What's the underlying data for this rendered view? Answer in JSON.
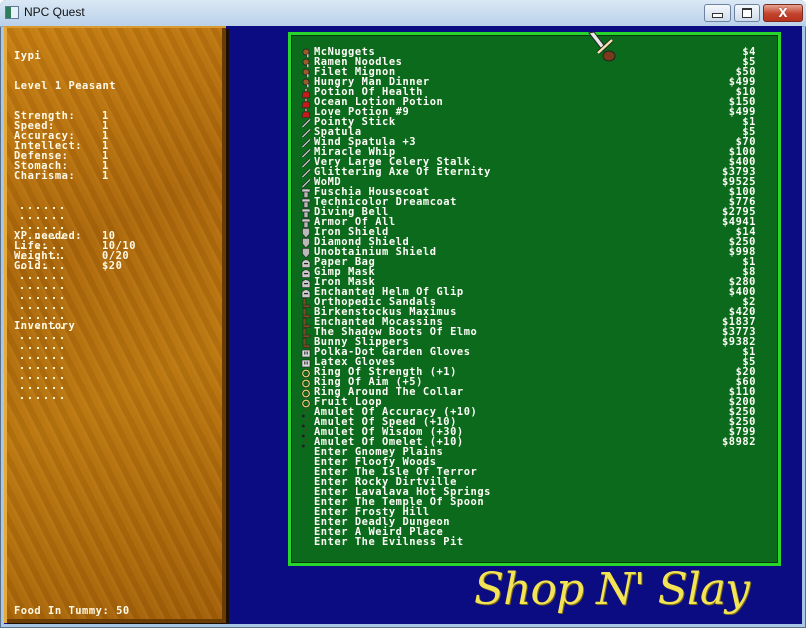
{
  "window": {
    "title": "NPC Quest",
    "controls": {
      "minimize": "minimize",
      "maximize": "maximize",
      "close": "X"
    }
  },
  "character": {
    "name": "Iypi",
    "level_line": "Level 1 Peasant",
    "stats": [
      {
        "label": "Strength:",
        "value": "1"
      },
      {
        "label": "Speed:",
        "value": "1"
      },
      {
        "label": "Accuracy:",
        "value": "1"
      },
      {
        "label": "Intellect:",
        "value": "1"
      },
      {
        "label": "Defense:",
        "value": "1"
      },
      {
        "label": "Stomach:",
        "value": "1"
      },
      {
        "label": "Charisma:",
        "value": "1"
      }
    ],
    "status": [
      {
        "label": "XP needed:",
        "value": "10"
      },
      {
        "label": "Life:",
        "value": "10/10"
      },
      {
        "label": "Weight:",
        "value": "0/20"
      },
      {
        "label": "Gold:",
        "value": "$20"
      }
    ],
    "inventory_label": "Inventory",
    "inventory_empty_slots": 20,
    "food_line": "Food In Tummy: 50"
  },
  "shop": {
    "items": [
      {
        "icon": "food",
        "name": "McNuggets",
        "price": "$4"
      },
      {
        "icon": "food",
        "name": "Ramen Noodles",
        "price": "$5"
      },
      {
        "icon": "food",
        "name": "Filet Mignon",
        "price": "$50"
      },
      {
        "icon": "food",
        "name": "Hungry Man Dinner",
        "price": "$499"
      },
      {
        "icon": "potion",
        "name": "Potion Of Health",
        "price": "$10"
      },
      {
        "icon": "potion",
        "name": "Ocean Lotion Potion",
        "price": "$150"
      },
      {
        "icon": "potion",
        "name": "Love Potion #9",
        "price": "$499"
      },
      {
        "icon": "weapon",
        "name": "Pointy Stick",
        "price": "$1"
      },
      {
        "icon": "weapon",
        "name": "Spatula",
        "price": "$5"
      },
      {
        "icon": "weapon",
        "name": "Wind Spatula +3",
        "price": "$70"
      },
      {
        "icon": "weapon",
        "name": "Miracle Whip",
        "price": "$100"
      },
      {
        "icon": "weapon",
        "name": "Very Large Celery Stalk",
        "price": "$400"
      },
      {
        "icon": "weapon",
        "name": "Glittering Axe Of Eternity",
        "price": "$3793"
      },
      {
        "icon": "weapon",
        "name": "WoMD",
        "price": "$9525"
      },
      {
        "icon": "armor",
        "name": "Fuschia Housecoat",
        "price": "$100"
      },
      {
        "icon": "armor",
        "name": "Technicolor Dreamcoat",
        "price": "$776"
      },
      {
        "icon": "armor",
        "name": "Diving Bell",
        "price": "$2795"
      },
      {
        "icon": "armor",
        "name": "Armor Of All",
        "price": "$4941"
      },
      {
        "icon": "shield",
        "name": "Iron Shield",
        "price": "$14"
      },
      {
        "icon": "shield",
        "name": "Diamond Shield",
        "price": "$250"
      },
      {
        "icon": "shield",
        "name": "Unobtainium Shield",
        "price": "$998"
      },
      {
        "icon": "helmet",
        "name": "Paper Bag",
        "price": "$1"
      },
      {
        "icon": "helmet",
        "name": "Gimp Mask",
        "price": "$8"
      },
      {
        "icon": "helmet",
        "name": "Iron Mask",
        "price": "$280"
      },
      {
        "icon": "helmet",
        "name": "Enchanted Helm Of Glip",
        "price": "$400"
      },
      {
        "icon": "boots",
        "name": "Orthopedic Sandals",
        "price": "$2"
      },
      {
        "icon": "boots",
        "name": "Birkenstockus Maximus",
        "price": "$420"
      },
      {
        "icon": "boots",
        "name": "Enchanted Mocassins",
        "price": "$1837"
      },
      {
        "icon": "boots",
        "name": "The Shadow Boots Of Elmo",
        "price": "$3773"
      },
      {
        "icon": "boots",
        "name": "Bunny Slippers",
        "price": "$9382"
      },
      {
        "icon": "gloves",
        "name": "Polka-Dot Garden Gloves",
        "price": "$1"
      },
      {
        "icon": "gloves",
        "name": "Latex Gloves",
        "price": "$5"
      },
      {
        "icon": "ring",
        "name": "Ring Of Strength (+1)",
        "price": "$20"
      },
      {
        "icon": "ring",
        "name": "Ring Of Aim (+5)",
        "price": "$60"
      },
      {
        "icon": "ring",
        "name": "Ring Around The Collar",
        "price": "$110"
      },
      {
        "icon": "ring",
        "name": "Fruit Loop",
        "price": "$200"
      },
      {
        "icon": "amulet",
        "name": "Amulet Of Accuracy (+10)",
        "price": "$250"
      },
      {
        "icon": "amulet",
        "name": "Amulet Of Speed (+10)",
        "price": "$250"
      },
      {
        "icon": "amulet",
        "name": "Amulet Of Wisdom (+30)",
        "price": "$799"
      },
      {
        "icon": "amulet",
        "name": "Amulet Of Omelet (+10)",
        "price": "$8982"
      }
    ],
    "destinations": [
      "Enter Gnomey Plains",
      "Enter Floofy Woods",
      "Enter The Isle Of Terror",
      "Enter Rocky Dirtville",
      "Enter Lavalava Hot Springs",
      "Enter The Temple Of Spoon",
      "Enter Frosty Hill",
      "Enter Deadly Dungeon",
      "Enter A Weird Place",
      "Enter The Evilness Pit"
    ],
    "cursor": "sword-cursor-icon"
  },
  "logo": {
    "text": "Shop N' Slay"
  },
  "colors": {
    "background_blue": "#0b0b82",
    "shop_green": "#0b6a1c",
    "shop_border": "#27d52c",
    "logo_yellow": "#f3e457",
    "wood": "#b0690c"
  }
}
